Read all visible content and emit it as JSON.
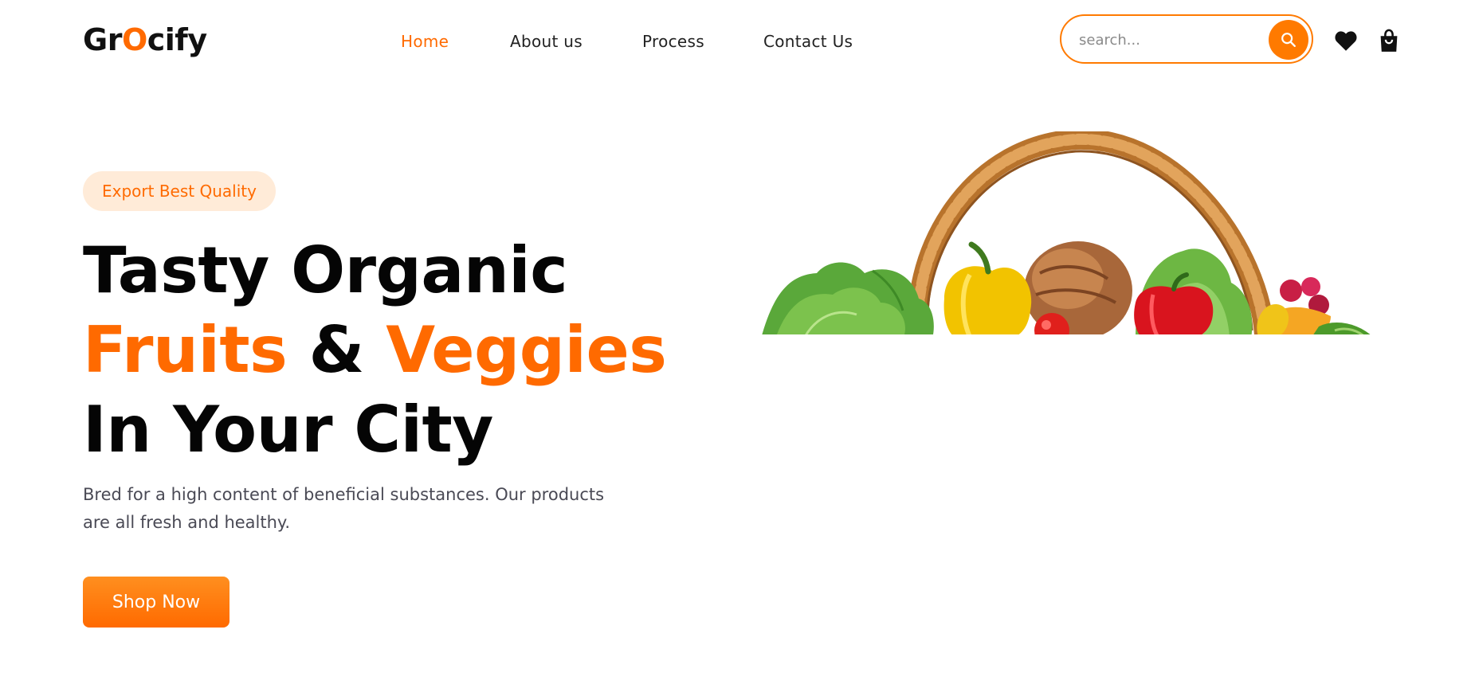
{
  "brand": {
    "logo_prefix": "Gr",
    "logo_accent": "O",
    "logo_suffix": "cify",
    "accent_color": "#ff6a00"
  },
  "nav": {
    "items": [
      {
        "label": "Home",
        "active": true
      },
      {
        "label": "About us",
        "active": false
      },
      {
        "label": "Process",
        "active": false
      },
      {
        "label": "Contact Us",
        "active": false
      }
    ]
  },
  "search": {
    "placeholder": "search..."
  },
  "icons": {
    "search": "search-icon",
    "wishlist": "heart-icon",
    "cart": "shopping-bag-icon"
  },
  "hero": {
    "badge": "Export Best Quality",
    "headline_line1": "Tasty Organic",
    "headline_word_fruits": "Fruits",
    "headline_ampersand": " & ",
    "headline_word_veggies": "Veggies",
    "headline_line3": "In Your City",
    "description": "Bred for a high content of beneficial substances. Our products are all fresh and healthy.",
    "cta_label": "Shop Now"
  }
}
